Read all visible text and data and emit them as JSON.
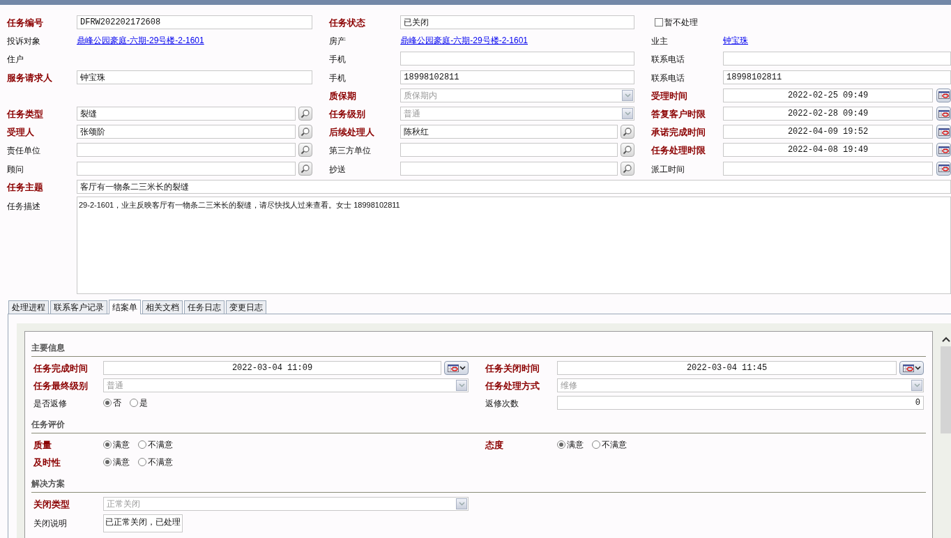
{
  "form": {
    "rows": [
      [
        {
          "label": "任务编号",
          "required": true,
          "kind": "text",
          "value": "DFRW202202172608",
          "mono": true
        },
        {
          "label": "任务状态",
          "required": true,
          "kind": "text",
          "value": "已关闭"
        },
        {
          "kind": "checkbox",
          "label": "暂不处理",
          "checked": false
        }
      ],
      [
        {
          "label": "投诉对象",
          "required": false,
          "kind": "link",
          "value": "鼎峰公园豪庭-六期-29号楼-2-1601"
        },
        {
          "label": "房产",
          "required": false,
          "kind": "link",
          "value": "鼎峰公园豪庭-六期-29号楼-2-1601"
        },
        {
          "label": "业主",
          "required": false,
          "kind": "link",
          "value": "钟宝珠"
        }
      ],
      [
        {
          "label": "住户",
          "required": false,
          "kind": "none"
        },
        {
          "label": "手机",
          "required": false,
          "kind": "text"
        },
        {
          "label": "联系电话",
          "required": false,
          "kind": "text"
        }
      ],
      [
        {
          "label": "服务请求人",
          "required": true,
          "kind": "text",
          "value": "钟宝珠"
        },
        {
          "label": "手机",
          "required": false,
          "kind": "text",
          "value": "18998102811",
          "mono": true
        },
        {
          "label": "联系电话",
          "required": false,
          "kind": "text",
          "value": "18998102811",
          "mono": true
        }
      ],
      [
        {
          "kind": "blank"
        },
        {
          "label": "质保期",
          "required": true,
          "kind": "select",
          "value": "质保期内",
          "disabled": true
        },
        {
          "label": "受理时间",
          "required": true,
          "kind": "date",
          "value": "2022-02-25 09:49"
        }
      ],
      [
        {
          "label": "任务类型",
          "required": true,
          "kind": "lookup",
          "value": "裂缝"
        },
        {
          "label": "任务级别",
          "required": true,
          "kind": "select",
          "value": "普通",
          "disabled": true
        },
        {
          "label": "答复客户时限",
          "required": true,
          "kind": "date",
          "value": "2022-02-28 09:49"
        }
      ],
      [
        {
          "label": "受理人",
          "required": true,
          "kind": "lookup",
          "value": "张颂阶"
        },
        {
          "label": "后续处理人",
          "required": true,
          "kind": "lookup",
          "value": "陈秋红"
        },
        {
          "label": "承诺完成时间",
          "required": true,
          "kind": "date",
          "value": "2022-04-09 19:52"
        }
      ],
      [
        {
          "label": "责任单位",
          "required": false,
          "kind": "lookup"
        },
        {
          "label": "第三方单位",
          "required": false,
          "kind": "lookup"
        },
        {
          "label": "任务处理时限",
          "required": true,
          "kind": "date",
          "value": "2022-04-08 19:49"
        }
      ],
      [
        {
          "label": "顾问",
          "required": false,
          "kind": "lookup"
        },
        {
          "label": "抄送",
          "required": false,
          "kind": "lookup"
        },
        {
          "label": "派工时间",
          "required": false,
          "kind": "date"
        }
      ]
    ],
    "subject": {
      "label": "任务主题",
      "required": true,
      "value": "客厅有一物条二三米长的裂缝"
    },
    "description": {
      "label": "任务描述",
      "required": false,
      "value": "29-2-1601，业主反映客厅有一物条二三米长的裂缝，请尽快找人过来查看。女士 18998102811"
    }
  },
  "tabs": [
    {
      "label": "处理进程",
      "selected": false
    },
    {
      "label": "联系客户记录",
      "selected": false
    },
    {
      "label": "结案单",
      "selected": true
    },
    {
      "label": "相关文档",
      "selected": false
    },
    {
      "label": "任务日志",
      "selected": false
    },
    {
      "label": "变更日志",
      "selected": false
    }
  ],
  "closing": {
    "sections": [
      {
        "title": "主要信息",
        "rows": [
          [
            {
              "label": "任务完成时间",
              "required": true,
              "kind": "date",
              "value": "2022-03-04 11:09"
            },
            {
              "label": "任务关闭时间",
              "required": true,
              "kind": "date",
              "value": "2022-03-04 11:45"
            }
          ],
          [
            {
              "label": "任务最终级别",
              "required": true,
              "kind": "select",
              "value": "普通",
              "disabled": true
            },
            {
              "label": "任务处理方式",
              "required": true,
              "kind": "select",
              "value": "维修",
              "disabled": true
            }
          ],
          [
            {
              "label": "是否返修",
              "required": false,
              "kind": "radio",
              "options": [
                {
                  "label": "否",
                  "selected": true
                },
                {
                  "label": "是",
                  "selected": false
                }
              ]
            },
            {
              "label": "返修次数",
              "required": false,
              "kind": "number",
              "value": "0"
            }
          ]
        ]
      },
      {
        "title": "任务评价",
        "rows": [
          [
            {
              "label": "质量",
              "required": true,
              "kind": "radio",
              "options": [
                {
                  "label": "满意",
                  "selected": true
                },
                {
                  "label": "不满意",
                  "selected": false
                }
              ]
            },
            {
              "label": "态度",
              "required": true,
              "kind": "radio",
              "options": [
                {
                  "label": "满意",
                  "selected": true
                },
                {
                  "label": "不满意",
                  "selected": false
                }
              ]
            }
          ],
          [
            {
              "label": "及时性",
              "required": true,
              "kind": "radio",
              "options": [
                {
                  "label": "满意",
                  "selected": true
                },
                {
                  "label": "不满意",
                  "selected": false
                }
              ]
            }
          ]
        ]
      },
      {
        "title": "解决方案",
        "rows": [
          [
            {
              "label": "关闭类型",
              "required": true,
              "kind": "select",
              "value": "正常关闭",
              "disabled": true
            }
          ],
          [
            {
              "label": "关闭说明",
              "required": false,
              "kind": "textarea",
              "value": "已正常关闭，已处理"
            }
          ]
        ]
      }
    ]
  }
}
